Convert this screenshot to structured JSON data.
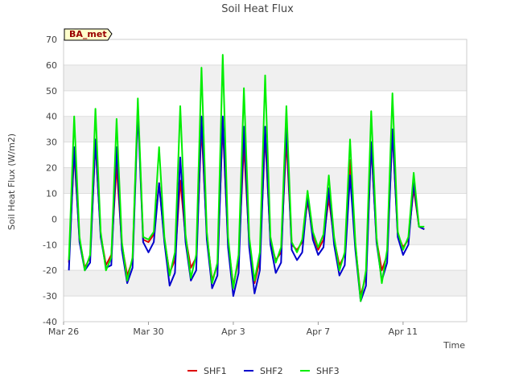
{
  "chart_data": {
    "type": "line",
    "title": "Soil Heat Flux",
    "xlabel": "Time",
    "ylabel": "Soil Heat Flux (W/m2)",
    "site_label": "BA_met",
    "x_unit": "day",
    "xlim": [
      "Mar 26",
      "Apr 14"
    ],
    "ylim": [
      -40,
      70
    ],
    "yticks": [
      -40,
      -30,
      -20,
      -10,
      0,
      10,
      20,
      30,
      40,
      50,
      60,
      70
    ],
    "xticks": [
      {
        "x": "Mar 26",
        "label": "Mar 26"
      },
      {
        "x": "Mar 30",
        "label": "Mar 30"
      },
      {
        "x": "Apr 3",
        "label": "Apr 3"
      },
      {
        "x": "Apr 7",
        "label": "Apr 7"
      },
      {
        "x": "Apr 11",
        "label": "Apr 11"
      }
    ],
    "grid": "horizontal bands",
    "legend_position": "bottom-center",
    "x": [
      "Mar 26 06:00",
      "Mar 26 12:00",
      "Mar 26 18:00",
      "Mar 27 00:00",
      "Mar 27 06:00",
      "Mar 27 12:00",
      "Mar 27 18:00",
      "Mar 28 00:00",
      "Mar 28 06:00",
      "Mar 28 12:00",
      "Mar 28 18:00",
      "Mar 29 00:00",
      "Mar 29 06:00",
      "Mar 29 12:00",
      "Mar 29 18:00",
      "Mar 30 00:00",
      "Mar 30 06:00",
      "Mar 30 12:00",
      "Mar 30 18:00",
      "Mar 31 00:00",
      "Mar 31 06:00",
      "Mar 31 12:00",
      "Mar 31 18:00",
      "Apr 1 00:00",
      "Apr 1 06:00",
      "Apr 1 12:00",
      "Apr 1 18:00",
      "Apr 2 00:00",
      "Apr 2 06:00",
      "Apr 2 12:00",
      "Apr 2 18:00",
      "Apr 3 00:00",
      "Apr 3 06:00",
      "Apr 3 12:00",
      "Apr 3 18:00",
      "Apr 4 00:00",
      "Apr 4 06:00",
      "Apr 4 12:00",
      "Apr 4 18:00",
      "Apr 5 00:00",
      "Apr 5 06:00",
      "Apr 5 12:00",
      "Apr 5 18:00",
      "Apr 6 00:00",
      "Apr 6 06:00",
      "Apr 6 12:00",
      "Apr 6 18:00",
      "Apr 7 00:00",
      "Apr 7 06:00",
      "Apr 7 12:00",
      "Apr 7 18:00",
      "Apr 8 00:00",
      "Apr 8 06:00",
      "Apr 8 12:00",
      "Apr 8 18:00",
      "Apr 9 00:00",
      "Apr 9 06:00",
      "Apr 9 12:00",
      "Apr 9 18:00",
      "Apr 10 00:00",
      "Apr 10 06:00",
      "Apr 10 12:00",
      "Apr 10 18:00",
      "Apr 11 00:00",
      "Apr 11 06:00",
      "Apr 11 12:00",
      "Apr 11 18:00",
      "Apr 12 00:00",
      "Apr 12 06:00",
      "Apr 12 12:00",
      "Apr 12 18:00",
      "Apr 13 00:00"
    ],
    "series": [
      {
        "name": "SHF1",
        "color": "#dd0000",
        "values": [
          -17,
          26,
          -8,
          -19,
          -15,
          30,
          -6,
          -18,
          -14,
          21,
          -10,
          -22,
          -16,
          44,
          -8,
          -9,
          -6,
          14,
          -8,
          -21,
          -16,
          15,
          -7,
          -19,
          -15,
          36,
          -6,
          -24,
          -18,
          37,
          -9,
          -26,
          -16,
          29,
          -9,
          -25,
          -16,
          33,
          -9,
          -16,
          -13,
          31,
          -10,
          -12,
          -9,
          7,
          -6,
          -12,
          -8,
          8,
          -8,
          -18,
          -14,
          23,
          -10,
          -30,
          -22,
          29,
          -8,
          -20,
          -14,
          34,
          -6,
          -11,
          -8,
          12,
          -3,
          -4
        ]
      },
      {
        "name": "SHF2",
        "color": "#0000cc",
        "values": [
          -20,
          28,
          -9,
          -20,
          -17,
          31,
          -7,
          -19,
          -18,
          28,
          -12,
          -25,
          -19,
          42,
          -9,
          -13,
          -9,
          14,
          -9,
          -26,
          -21,
          24,
          -9,
          -24,
          -20,
          40,
          -8,
          -27,
          -22,
          40,
          -11,
          -30,
          -21,
          36,
          -11,
          -29,
          -20,
          36,
          -10,
          -21,
          -17,
          37,
          -12,
          -16,
          -13,
          9,
          -8,
          -14,
          -11,
          12,
          -10,
          -22,
          -18,
          17,
          -12,
          -32,
          -26,
          30,
          -9,
          -24,
          -17,
          35,
          -7,
          -14,
          -10,
          14,
          -3,
          -4
        ]
      },
      {
        "name": "SHF3",
        "color": "#00ee00",
        "values": [
          -16,
          40,
          -7,
          -20,
          -14,
          43,
          -5,
          -20,
          -15,
          39,
          -9,
          -24,
          -15,
          47,
          -7,
          -8,
          -5,
          28,
          -7,
          -22,
          -13,
          44,
          -6,
          -23,
          -14,
          59,
          -5,
          -25,
          -17,
          64,
          -7,
          -27,
          -14,
          51,
          -7,
          -24,
          -13,
          56,
          -7,
          -17,
          -11,
          44,
          -9,
          -13,
          -8,
          11,
          -5,
          -11,
          -6,
          17,
          -7,
          -20,
          -13,
          31,
          -9,
          -32,
          -20,
          42,
          -7,
          -25,
          -12,
          49,
          -5,
          -12,
          -7,
          18,
          -3,
          -3
        ]
      }
    ]
  }
}
